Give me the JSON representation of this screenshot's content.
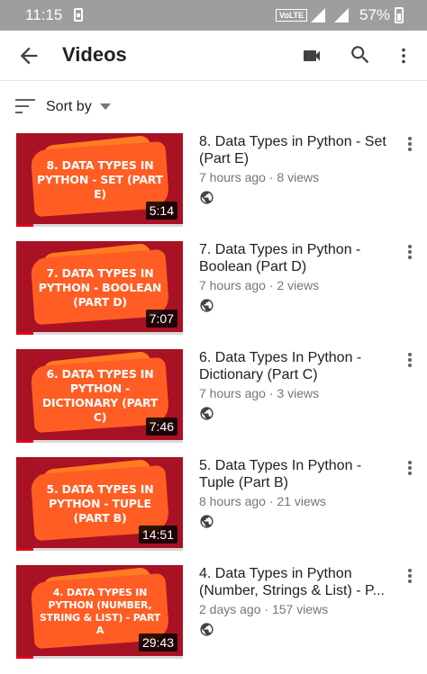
{
  "status_bar": {
    "time": "11:15",
    "network_badge": "VoLTE",
    "battery": "57%"
  },
  "app_bar": {
    "title": "Videos",
    "back_icon": "arrow-back-icon",
    "camera_icon": "video-camera-icon",
    "search_icon": "search-icon",
    "more_icon": "more-vertical-icon"
  },
  "sort": {
    "label": "Sort by",
    "icon": "sort-icon"
  },
  "videos": [
    {
      "thumb_text": "8. DATA TYPES IN PYTHON - SET (PART E)",
      "duration": "5:14",
      "title": "8. Data Types in Python - Set (Part E)",
      "age": "7 hours ago",
      "views": "8 views",
      "watched_fraction": 0.1
    },
    {
      "thumb_text": "7. DATA TYPES IN PYTHON - BOOLEAN (PART D)",
      "duration": "7:07",
      "title": "7. Data Types in Python - Boolean (Part D)",
      "age": "7 hours ago",
      "views": "2 views",
      "watched_fraction": 0.1
    },
    {
      "thumb_text": "6. DATA TYPES IN PYTHON - DICTIONARY (PART C)",
      "duration": "7:46",
      "title": "6. Data Types In Python - Dictionary (Part C)",
      "age": "7 hours ago",
      "views": "3 views",
      "watched_fraction": 0.1
    },
    {
      "thumb_text": "5. DATA TYPES IN PYTHON - TUPLE (PART B)",
      "duration": "14:51",
      "title": "5. Data Types In Python - Tuple (Part B)",
      "age": "8 hours ago",
      "views": "21 views",
      "watched_fraction": 0.1
    },
    {
      "thumb_text": "4. DATA TYPES IN PYTHON (NUMBER, STRING & LIST) - PART A",
      "duration": "29:43",
      "title": "4. Data Types in Python (Number, Strings & List) - P...",
      "age": "2 days ago",
      "views": "157 views",
      "watched_fraction": 0.1
    }
  ],
  "colors": {
    "status_bar": "#9e9e9e",
    "thumb_bg": "#a81224",
    "thumb_splash": "#ff5d23",
    "progress": "#e2001a"
  }
}
